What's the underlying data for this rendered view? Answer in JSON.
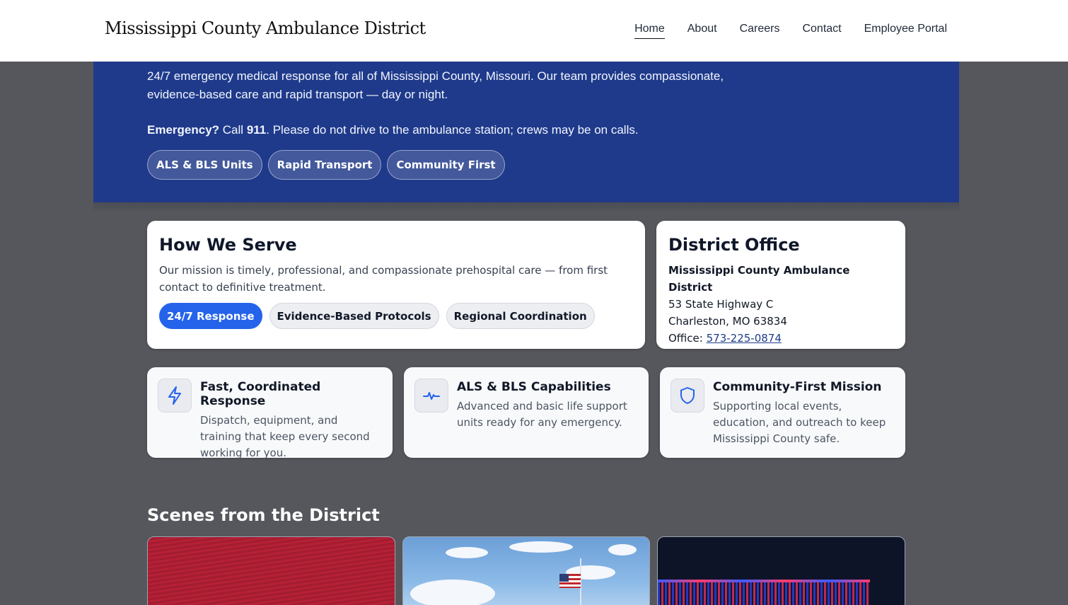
{
  "header": {
    "brand": "Mississippi County Ambulance District",
    "nav": [
      {
        "label": "Home"
      },
      {
        "label": "About"
      },
      {
        "label": "Careers"
      },
      {
        "label": "Contact"
      },
      {
        "label": "Employee Portal"
      }
    ]
  },
  "hero": {
    "description": "24/7 emergency medical response for all of Mississippi County, Missouri. Our team provides compassionate, evidence-based care and rapid transport — day or night.",
    "emergency_label": "Emergency?",
    "emergency_call": "Call",
    "emergency_number": "911",
    "emergency_note": ". Please do not drive to the ambulance station; crews may be on calls.",
    "chips": [
      "ALS & BLS Units",
      "Rapid Transport",
      "Community First"
    ]
  },
  "serve": {
    "title": "How We Serve",
    "text": "Our mission is timely, professional, and compassionate prehospital care — from first contact to definitive treatment.",
    "chips": [
      "24/7 Response",
      "Evidence-Based Protocols",
      "Regional Coordination"
    ]
  },
  "office": {
    "title": "District Office",
    "org": "Mississippi County Ambulance District",
    "address1": "53 State Highway C",
    "address2": "Charleston, MO 63834",
    "phone_label": "Office:",
    "phone": "573-225-0874"
  },
  "features": [
    {
      "icon": "lightning-icon",
      "title": "Fast, Coordinated Response",
      "text": "Dispatch, equipment, and training that keep every second working for you."
    },
    {
      "icon": "heartbeat-icon",
      "title": "ALS & BLS Capabilities",
      "text": "Advanced and basic life support units ready for any emergency."
    },
    {
      "icon": "shield-icon",
      "title": "Community-First Mission",
      "text": "Supporting local events, education, and outreach to keep Mississippi County safe."
    }
  ],
  "scenes": {
    "title": "Scenes from the District"
  },
  "colors": {
    "accent": "#2563eb",
    "hero": "#1f3a8a",
    "background": "#55575c"
  }
}
